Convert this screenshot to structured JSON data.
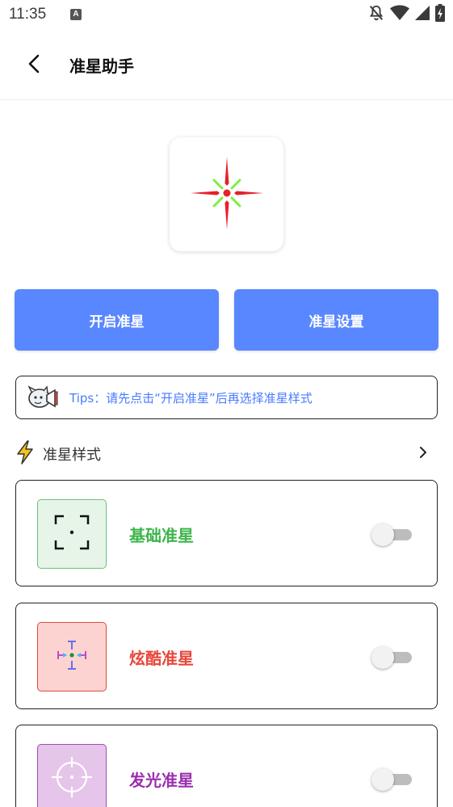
{
  "status_bar": {
    "time": "11:35",
    "notification_badge": "A",
    "icons": [
      "bell-off-icon",
      "wifi-icon",
      "signal-icon",
      "battery-charging-icon"
    ]
  },
  "header": {
    "back_icon": "chevron-left-icon",
    "title": "准星助手"
  },
  "preview": {
    "icon": "crosshair-star-icon",
    "colors": {
      "red": "#e8202a",
      "green": "#7cf040"
    }
  },
  "actions": {
    "start_label": "开启准星",
    "settings_label": "准星设置",
    "button_color": "#5987ff"
  },
  "tips": {
    "icon": "megaphone-mascot-icon",
    "text": "Tips：请先点击“开启准星”后再选择准星样式"
  },
  "styles_section": {
    "icon": "lightning-icon",
    "title": "准星样式",
    "more_icon": "chevron-right-icon"
  },
  "styles": [
    {
      "name": "基础准星",
      "color": "#3db54a",
      "thumb_bg": "#e6f5e8",
      "thumb_border": "#6cc07a",
      "icon": "basic-crosshair-icon",
      "enabled": false
    },
    {
      "name": "炫酷准星",
      "color": "#e8473c",
      "thumb_bg": "#fdd3d2",
      "thumb_border": "#e04a3e",
      "icon": "cool-crosshair-icon",
      "enabled": false
    },
    {
      "name": "发光准星",
      "color": "#9b2fae",
      "thumb_bg": "#e5c5ea",
      "thumb_border": "#a24bb3",
      "icon": "glow-crosshair-icon",
      "enabled": false
    }
  ]
}
